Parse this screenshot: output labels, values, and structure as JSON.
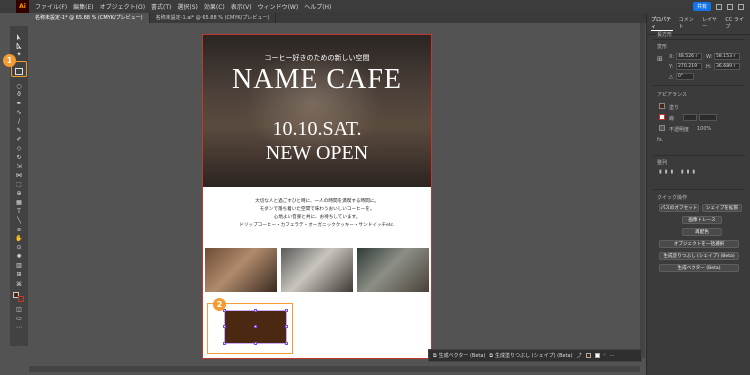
{
  "app": {
    "logo": "Ai",
    "brand_color": "#ff9a00",
    "accent": "#f39c34"
  },
  "menubar": {
    "items": [
      "ファイル(F)",
      "編集(E)",
      "オブジェクト(O)",
      "書式(T)",
      "選択(S)",
      "効果(C)",
      "表示(V)",
      "ウィンドウ(W)",
      "ヘルプ(H)"
    ],
    "share": "共有"
  },
  "tabs": [
    {
      "label": "名称未設定-1* @ 65.88 % (CMYK/プレビュー)",
      "active": true
    },
    {
      "label": "名称未設定-1.ai* @ 65.88 % (CMYK/プレビュー)",
      "active": false
    }
  ],
  "toolbar": {
    "icons": [
      "selection-tool-icon",
      "direct-selection-tool-icon",
      "rectangle-tool-icon",
      "ellipse-tool-icon",
      "lasso-tool-icon",
      "pen-tool-icon",
      "curvature-tool-icon",
      "paintbrush-tool-icon",
      "pencil-tool-icon",
      "eraser-tool-icon",
      "rotate-tool-icon",
      "scale-tool-icon",
      "width-tool-icon",
      "shape-builder-tool-icon",
      "gradient-tool-icon",
      "mesh-tool-icon",
      "type-tool-icon",
      "line-tool-icon",
      "hand-tool-icon",
      "zoom-tool-icon"
    ],
    "badge1": "1",
    "badge2": "2"
  },
  "artboard": {
    "subtitle": "コーヒー好きのための新しい空間",
    "title": "NAME CAFE",
    "date_line1": "10.10.SAT.",
    "date_line2": "NEW OPEN",
    "body_lines": [
      "大切な人と過ごすひと時に、一人の時間を満喫する時間に。",
      "モダンで落ち着いた空間で味わうおいしいコーヒーを。",
      "心地よい音楽と共に、お待ちしています。",
      "ドリップコーヒー・カフェラテ・オーガニッククッキー・サンドイッチetc."
    ]
  },
  "contextbar": {
    "generate_vector": "生成ベクター (Beta)",
    "generate_fill": "生成塗りつぶし (シェイプ) (Beta)"
  },
  "panel": {
    "tabs": [
      "プロパティ",
      "コメント",
      "レイヤー",
      "CC ライブ"
    ],
    "shape_type": "長方形",
    "transform_label": "変形",
    "x": "48.526 r",
    "y": "270.219",
    "w": "58.153 r",
    "h": "36.689 r",
    "angle": "0°",
    "appearance_label": "アピアランス",
    "fill_label": "塗り",
    "stroke_label": "線",
    "opacity_label": "不透明度",
    "opacity_value": "100%",
    "fx_label": "fx.",
    "align_label": "整列",
    "quick_actions_label": "クイック操作",
    "offset_path": "パスのオフセット",
    "expand_shape": "シェイプを拡張",
    "recolor": "再配色",
    "image_trace": "画像トレース",
    "arrange": "オブジェクトを一括選択",
    "gen_fill": "生成塗りつぶし (シェイプ) (Beta)",
    "gen_vector": "生成ベクター (Beta)",
    "fill_color": "#4a2812"
  }
}
